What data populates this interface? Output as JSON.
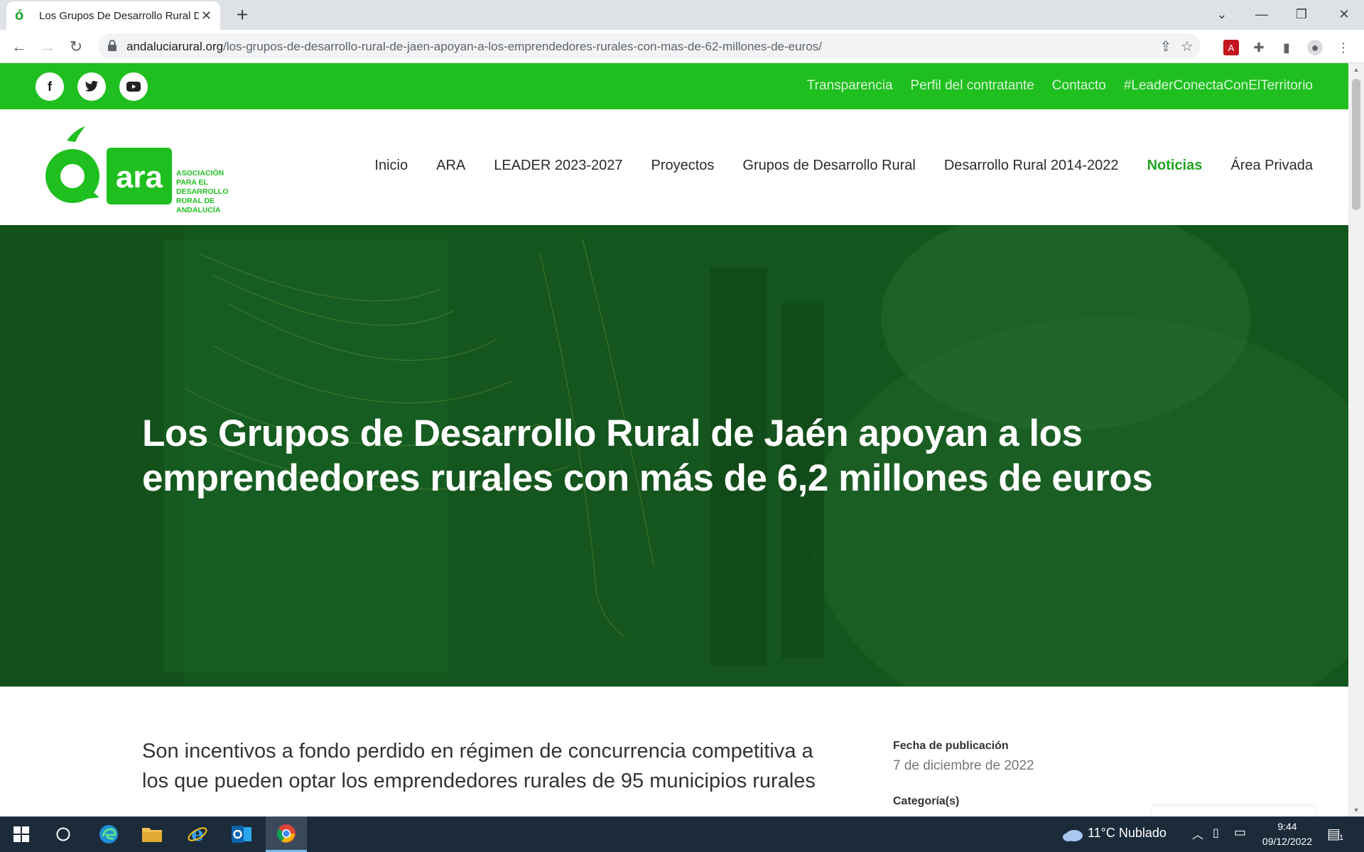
{
  "browser": {
    "tab_title": "Los Grupos De Desarrollo Rural D",
    "url_host": "andaluciarural.org",
    "url_path": "/los-grupos-de-desarrollo-rural-de-jaen-apoyan-a-los-emprendedores-rurales-con-mas-de-62-millones-de-euros/"
  },
  "topbar": {
    "social": [
      "facebook-icon",
      "twitter-icon",
      "youtube-icon"
    ],
    "links": [
      "Transparencia",
      "Perfil del contratante",
      "Contacto",
      "#LeaderConectaConElTerritorio"
    ]
  },
  "logo": {
    "wordmark": "ara",
    "tagline": [
      "ASOCIACIÓN",
      "PARA EL",
      "DESARROLLO",
      "RURAL DE",
      "ANDALUCÍA"
    ]
  },
  "nav": {
    "items": [
      "Inicio",
      "ARA",
      "LEADER 2023-2027",
      "Proyectos",
      "Grupos de Desarrollo Rural",
      "Desarrollo Rural 2014-2022",
      "Noticias",
      "Área Privada"
    ],
    "active": "Noticias"
  },
  "hero": {
    "title_line1": "Los Grupos de Desarrollo Rural de Jaén apoyan a los",
    "title_line2": "emprendedores rurales con más de 6,2 millones de euros"
  },
  "article": {
    "lead_line1": "Son incentivos a fondo perdido en régimen de concurrencia competitiva a",
    "lead_line2": "los que pueden optar los emprendedores rurales de 95 municipios rurales",
    "pub_label": "Fecha de publicación",
    "pub_date": "7 de diciembre de 2022",
    "cat_label": "Categoría(s)"
  },
  "taskbar": {
    "weather": "11°C  Nublado",
    "time": "9:44",
    "date": "09/12/2022",
    "notifications": "1"
  },
  "colors": {
    "brand_green": "#1fbf1f",
    "hero_green": "#145a1f",
    "active_nav": "#1fa51f"
  }
}
